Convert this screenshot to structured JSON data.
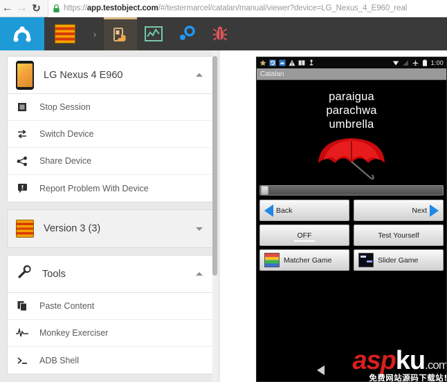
{
  "browser": {
    "back_icon": "arrow-left-icon",
    "forward_icon": "arrow-right-icon",
    "reload_icon": "reload-icon",
    "lock_icon": "lock-icon",
    "url_scheme": "https://",
    "url_host": "app.testobject.com",
    "url_path": "/#/testermarcel/catalan/manual/viewer?device=LG_Nexus_4_E960_real",
    "url_full": "https://app.testobject.com/#/testermarcel/catalan/manual/viewer?device=LG_Nexus_4_E960_real"
  },
  "toolbar": {
    "accent_blue": "#1e9bd7",
    "bg": "#3a3a3a",
    "active_tab_bg": "#4a453c",
    "active_tab_border": "#d9b787",
    "items": [
      {
        "name": "testobject-logo",
        "icon": "gear-logo-icon",
        "label": ""
      },
      {
        "name": "app-catalan",
        "icon": "catalan-flag-icon",
        "label": ""
      },
      {
        "name": "breadcrumb-chevron",
        "icon": "chevron-right-icon",
        "label": "›"
      },
      {
        "name": "manual-testing-tab",
        "icon": "hand-touch-device-icon",
        "label": "",
        "active": true
      },
      {
        "name": "reports-tab",
        "icon": "chart-line-icon",
        "label": ""
      },
      {
        "name": "settings-tab",
        "icon": "gears-icon",
        "label": ""
      },
      {
        "name": "bugs-tab",
        "icon": "bug-icon",
        "label": ""
      }
    ]
  },
  "sidebar": {
    "device_card": {
      "title": "LG Nexus 4 E960",
      "thumb_icon": "phone-thumbnail-icon",
      "caret": "chevron-up-icon"
    },
    "device_menu": [
      {
        "label": "Stop Session",
        "icon": "stop-square-icon"
      },
      {
        "label": "Switch Device",
        "icon": "switch-arrows-icon"
      },
      {
        "label": "Share Device",
        "icon": "share-nodes-icon"
      },
      {
        "label": "Report Problem With Device",
        "icon": "report-flag-icon"
      }
    ],
    "version_card": {
      "title": "Version 3 (3)",
      "icon": "catalan-flag-icon",
      "caret": "chevron-down-icon"
    },
    "tools_card": {
      "title": "Tools",
      "icon": "wrench-icon",
      "caret": "chevron-up-icon"
    },
    "tools_menu": [
      {
        "label": "Paste Content",
        "icon": "paste-icon"
      },
      {
        "label": "Monkey Exerciser",
        "icon": "waveform-icon"
      },
      {
        "label": "ADB Shell",
        "icon": "terminal-prompt-icon"
      }
    ],
    "collapse_handle_icon": "chevron-left-icon"
  },
  "device": {
    "status_bar": {
      "left_icons": [
        "star-icon",
        "sync-icon",
        "cloud-icon",
        "warning-triangle-icon",
        "book-icon",
        "usb-icon"
      ],
      "right_icons": [
        "wifi-icon",
        "signal-icon",
        "airplane-mode-icon",
        "battery-icon"
      ],
      "time": "1:00"
    },
    "action_bar": {
      "title": "Catalan"
    },
    "content": {
      "word_catalan": "paraigua",
      "word_welsh": "parachwa",
      "word_english": "umbrella",
      "image": "red-umbrella-image"
    },
    "buttons": [
      {
        "label": "Back",
        "icon": "triangle-left-icon",
        "align": "left"
      },
      {
        "label": "Next",
        "icon": "triangle-right-icon",
        "align": "right"
      },
      {
        "label": "OFF",
        "icon": "",
        "align": "center"
      },
      {
        "label": "Test Yourself",
        "icon": "",
        "align": "center"
      },
      {
        "label": "Matcher Game",
        "icon": "color-grid-icon",
        "align": "left"
      },
      {
        "label": "Slider Game",
        "icon": "slider-tiles-icon",
        "align": "left"
      }
    ],
    "nav_bar": {
      "back_icon": "android-back-triangle-icon"
    }
  },
  "watermark": {
    "part1": "asp",
    "part2": "ku",
    "part3": ".com",
    "subtitle": "免费网站源码下载站!"
  }
}
